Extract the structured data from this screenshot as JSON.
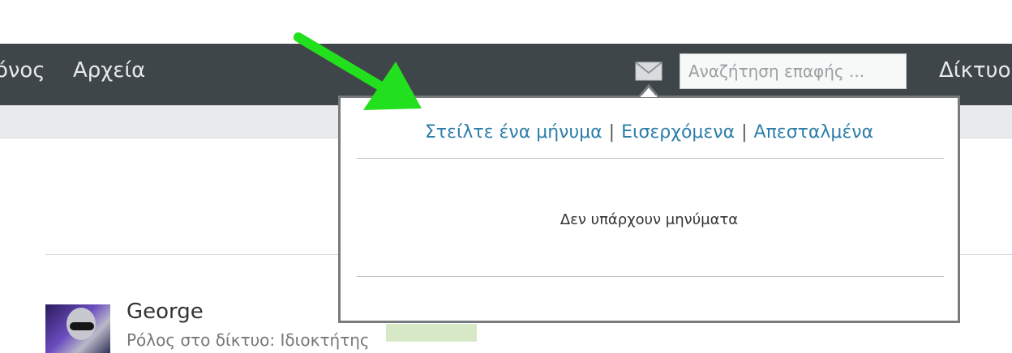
{
  "nav": {
    "partial_item": "όνος",
    "files": "Αρχεία",
    "network": "Δίκτυο"
  },
  "search": {
    "placeholder": "Αναζήτηση επαφής ..."
  },
  "messages_popup": {
    "send_link": "Στείλτε ένα μήνυμα",
    "separator": "|",
    "inbox_link": "Εισερχόμενα",
    "sent_link": "Απεσταλμένα",
    "empty_text": "Δεν υπάρχουν μηνύματα"
  },
  "profile": {
    "name": "George",
    "role": "Ρόλος στο δίκτυο: Ιδιοκτήτης"
  },
  "icons": {
    "mail": "envelope-icon",
    "annotation": "green-arrow-icon"
  },
  "colors": {
    "topbar": "#3f4649",
    "link": "#2d7ea8",
    "arrow": "#22e01e"
  }
}
